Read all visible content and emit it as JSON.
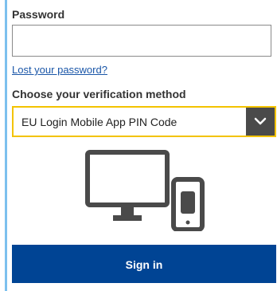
{
  "password": {
    "label": "Password",
    "value": "",
    "placeholder": ""
  },
  "lost_password_link": "Lost your password?",
  "verification": {
    "label": "Choose your verification method",
    "selected": "EU Login Mobile App PIN Code"
  },
  "icons": {
    "dropdown": "chevron-down-icon",
    "illustration": "desktop-and-mobile-icon"
  },
  "sign_in_label": "Sign in",
  "colors": {
    "accent_border": "#f3c300",
    "primary_button": "#004494",
    "link": "#1a56a8",
    "side_rule": "#7cc0ee"
  }
}
